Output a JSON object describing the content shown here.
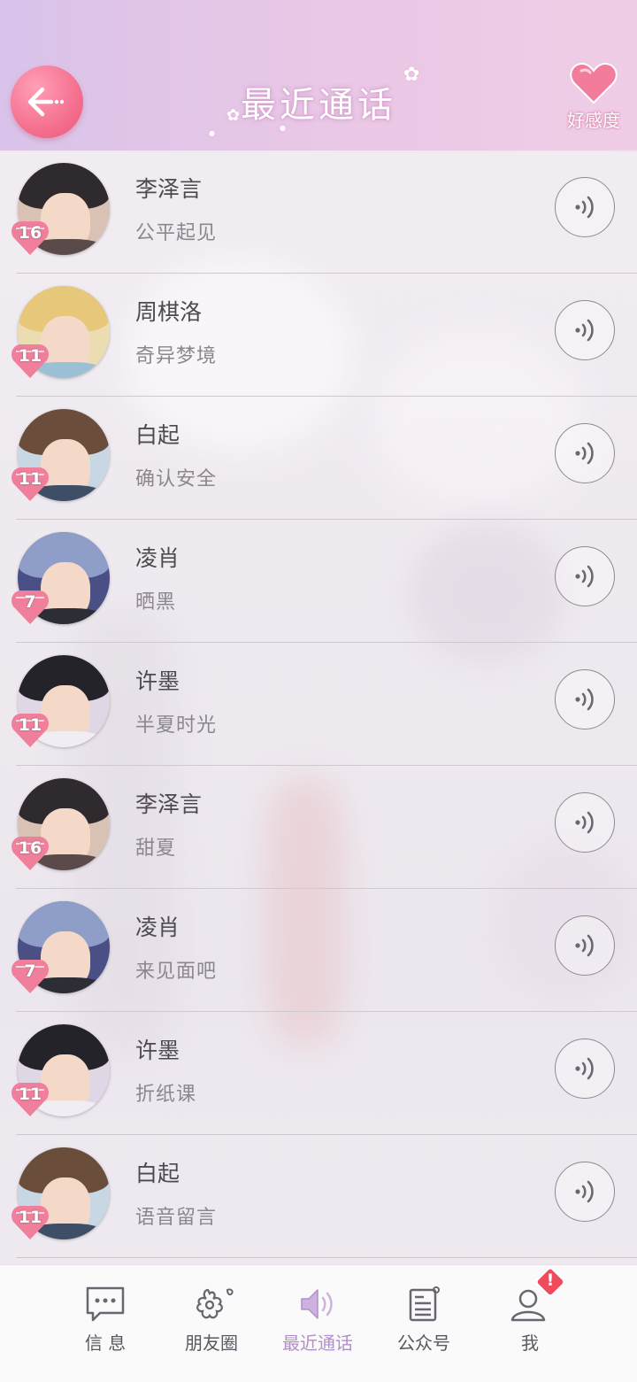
{
  "header": {
    "title": "最近通话",
    "back_icon": "arrow-left-icon",
    "affinity_label": "好感度",
    "affinity_icon": "heart-icon"
  },
  "calls": [
    {
      "name": "李泽言",
      "subtitle": "公平起见",
      "level": "16",
      "character": "lize"
    },
    {
      "name": "周棋洛",
      "subtitle": "奇异梦境",
      "level": "11",
      "character": "zhou"
    },
    {
      "name": "白起",
      "subtitle": "确认安全",
      "level": "11",
      "character": "bai"
    },
    {
      "name": "凌肖",
      "subtitle": "晒黑",
      "level": "7",
      "character": "ling"
    },
    {
      "name": "许墨",
      "subtitle": "半夏时光",
      "level": "11",
      "character": "xu"
    },
    {
      "name": "李泽言",
      "subtitle": "甜夏",
      "level": "16",
      "character": "lize"
    },
    {
      "name": "凌肖",
      "subtitle": "来见面吧",
      "level": "7",
      "character": "ling"
    },
    {
      "name": "许墨",
      "subtitle": "折纸课",
      "level": "11",
      "character": "xu"
    },
    {
      "name": "白起",
      "subtitle": "语音留言",
      "level": "11",
      "character": "bai"
    }
  ],
  "call_icon": "voice-call-icon",
  "nav": [
    {
      "label": "信 息",
      "icon": "message-icon",
      "active": false
    },
    {
      "label": "朋友圈",
      "icon": "flower-icon",
      "active": false
    },
    {
      "label": "最近通话",
      "icon": "speaker-icon",
      "active": true
    },
    {
      "label": "公众号",
      "icon": "newspaper-icon",
      "active": false
    },
    {
      "label": "我",
      "icon": "person-icon",
      "active": false,
      "badge": "!"
    }
  ],
  "colors": {
    "header_left": "#d9c3ea",
    "header_right": "#f0cde6",
    "back_button": "#f5708f",
    "heart": "#f27c9b",
    "level_badge": "#f07f9c",
    "active_nav": "#b28fc8"
  }
}
